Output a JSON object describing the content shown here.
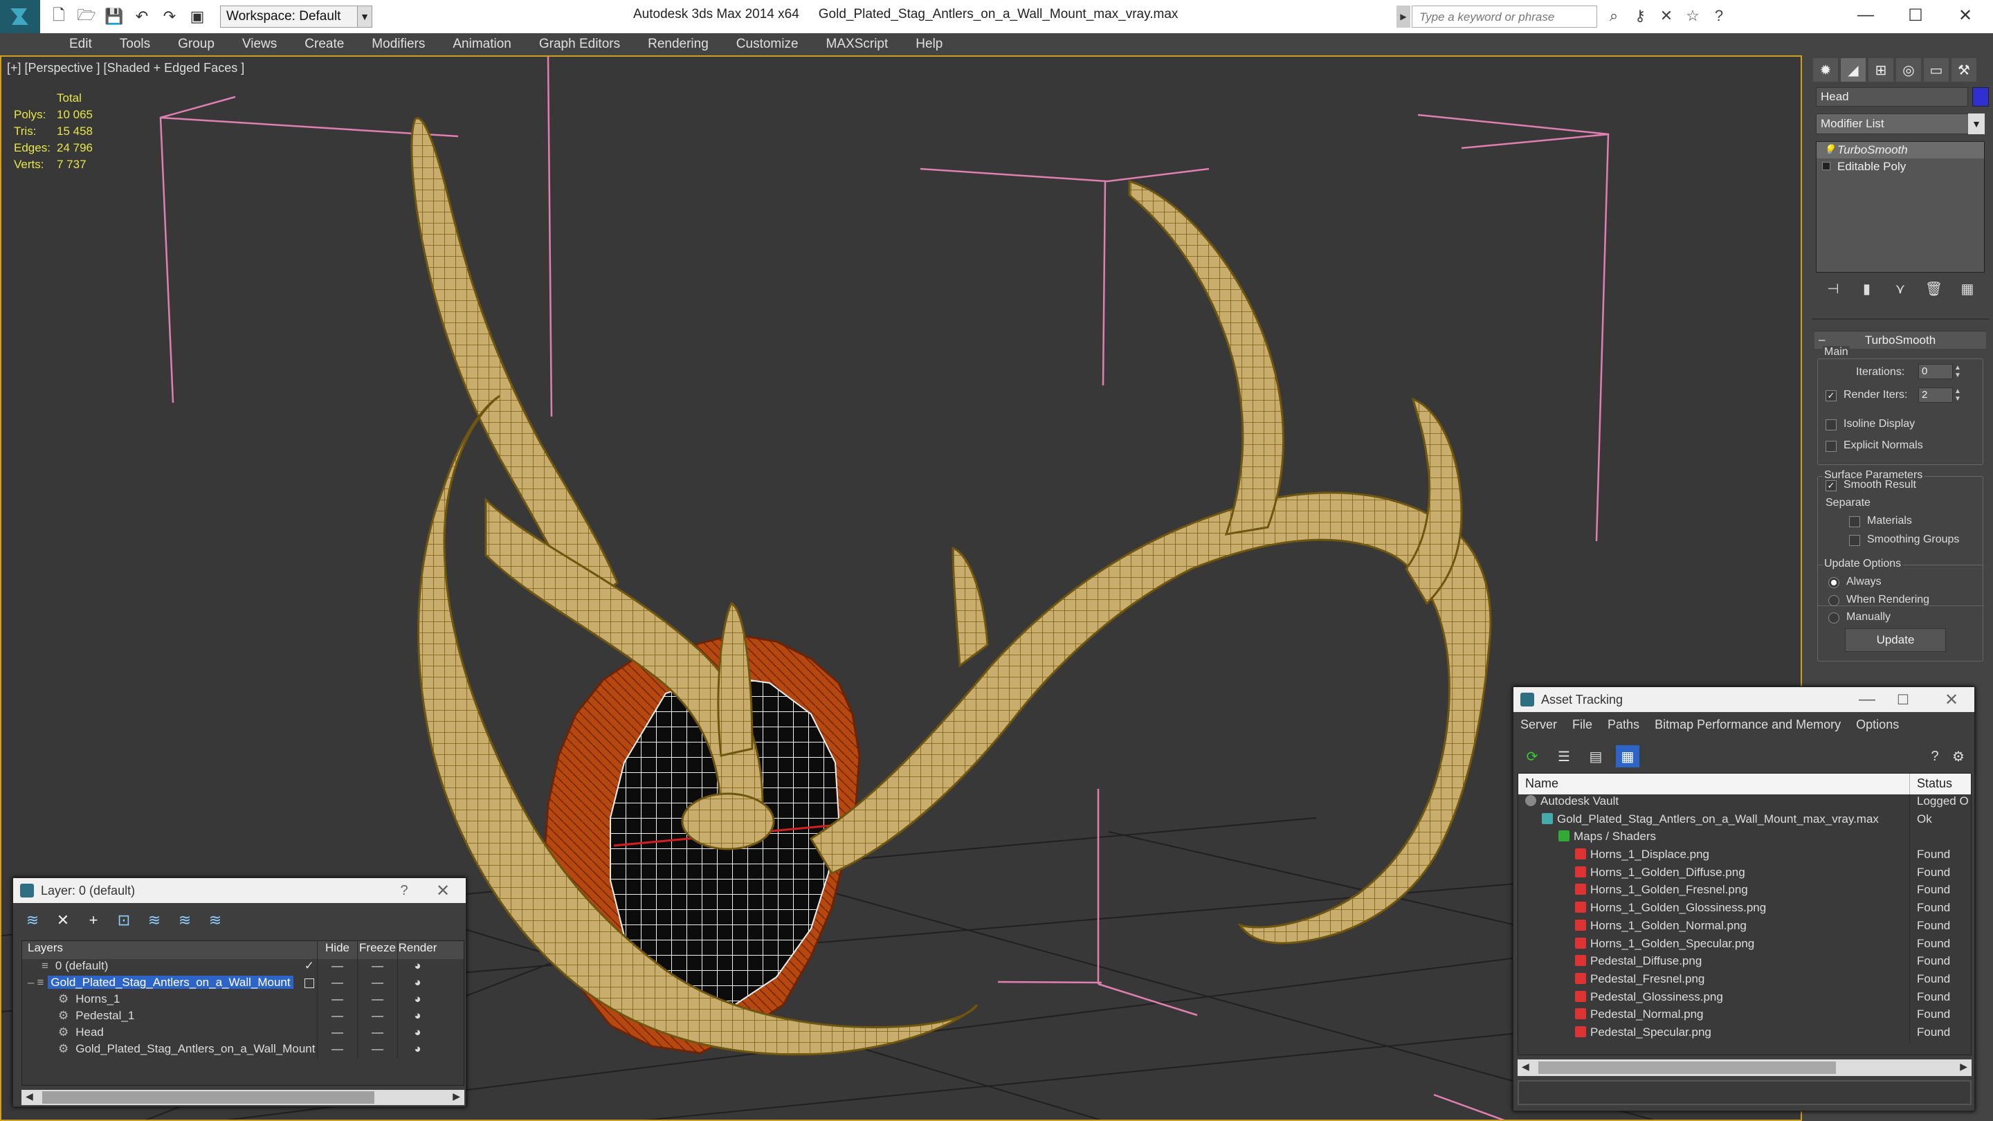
{
  "titlebar": {
    "workspace_label": "Workspace: Default",
    "app_name": "Autodesk 3ds Max  2014 x64",
    "file_name": "Gold_Plated_Stag_Antlers_on_a_Wall_Mount_max_vray.max",
    "search_placeholder": "Type a keyword or phrase"
  },
  "menu": [
    "Edit",
    "Tools",
    "Group",
    "Views",
    "Create",
    "Modifiers",
    "Animation",
    "Graph Editors",
    "Rendering",
    "Customize",
    "MAXScript",
    "Help"
  ],
  "viewport": {
    "label": "[+] [Perspective ] [Shaded + Edged Faces ]",
    "stats_header": "Total",
    "stats": [
      {
        "k": "Polys:",
        "v": "10 065"
      },
      {
        "k": "Tris:",
        "v": "15 458"
      },
      {
        "k": "Edges:",
        "v": "24 796"
      },
      {
        "k": "Verts:",
        "v": "7 737"
      }
    ]
  },
  "command_panel": {
    "object_name": "Head",
    "object_color": "#3030d0",
    "modifier_list": "Modifier List",
    "stack": [
      "TurboSmooth",
      "Editable Poly"
    ],
    "rollout_title": "TurboSmooth",
    "main_label": "Main",
    "iterations_label": "Iterations:",
    "iterations_value": "0",
    "render_iters_label": "Render Iters:",
    "render_iters_value": "2",
    "render_iters_checked": true,
    "isoline_label": "Isoline Display",
    "explicit_label": "Explicit Normals",
    "surface_label": "Surface Parameters",
    "smooth_result_label": "Smooth Result",
    "separate_label": "Separate",
    "materials_label": "Materials",
    "smoothing_groups_label": "Smoothing Groups",
    "update_options_label": "Update Options",
    "always_label": "Always",
    "when_rendering_label": "When Rendering",
    "manually_label": "Manually",
    "update_button": "Update"
  },
  "layer_dialog": {
    "title": "Layer: 0 (default)",
    "help": "?",
    "columns": [
      "Layers",
      "Hide",
      "Freeze",
      "Render"
    ],
    "rows": [
      {
        "name": "0 (default)",
        "indent": 1,
        "selected": false
      },
      {
        "name": "Gold_Plated_Stag_Antlers_on_a_Wall_Mount",
        "indent": 1,
        "selected": true
      },
      {
        "name": "Horns_1",
        "indent": 2,
        "selected": false
      },
      {
        "name": "Pedestal_1",
        "indent": 2,
        "selected": false
      },
      {
        "name": "Head",
        "indent": 2,
        "selected": false
      },
      {
        "name": "Gold_Plated_Stag_Antlers_on_a_Wall_Mount",
        "indent": 2,
        "selected": false
      }
    ]
  },
  "asset_dialog": {
    "title": "Asset Tracking",
    "menu": [
      "Server",
      "File",
      "Paths",
      "Bitmap Performance and Memory",
      "Options"
    ],
    "col_name": "Name",
    "col_status": "Status",
    "rows": [
      {
        "name": "Autodesk Vault",
        "status": "Logged O",
        "indent": 0,
        "icon": "vault"
      },
      {
        "name": "Gold_Plated_Stag_Antlers_on_a_Wall_Mount_max_vray.max",
        "status": "Ok",
        "indent": 1,
        "icon": "max"
      },
      {
        "name": "Maps / Shaders",
        "status": "",
        "indent": 2,
        "icon": "folder"
      },
      {
        "name": "Horns_1_Displace.png",
        "status": "Found",
        "indent": 3,
        "icon": "png"
      },
      {
        "name": "Horns_1_Golden_Diffuse.png",
        "status": "Found",
        "indent": 3,
        "icon": "png"
      },
      {
        "name": "Horns_1_Golden_Fresnel.png",
        "status": "Found",
        "indent": 3,
        "icon": "png"
      },
      {
        "name": "Horns_1_Golden_Glossiness.png",
        "status": "Found",
        "indent": 3,
        "icon": "png"
      },
      {
        "name": "Horns_1_Golden_Normal.png",
        "status": "Found",
        "indent": 3,
        "icon": "png"
      },
      {
        "name": "Horns_1_Golden_Specular.png",
        "status": "Found",
        "indent": 3,
        "icon": "png"
      },
      {
        "name": "Pedestal_Diffuse.png",
        "status": "Found",
        "indent": 3,
        "icon": "png"
      },
      {
        "name": "Pedestal_Fresnel.png",
        "status": "Found",
        "indent": 3,
        "icon": "png"
      },
      {
        "name": "Pedestal_Glossiness.png",
        "status": "Found",
        "indent": 3,
        "icon": "png"
      },
      {
        "name": "Pedestal_Normal.png",
        "status": "Found",
        "indent": 3,
        "icon": "png"
      },
      {
        "name": "Pedestal_Specular.png",
        "status": "Found",
        "indent": 3,
        "icon": "png"
      }
    ]
  },
  "colors": {
    "accent_selection": "#2d64c8",
    "viewport_border": "#d0a020",
    "antler_fill": "#c8ad6e",
    "pedestal": "#b5470f",
    "stats_text": "#e6e64a",
    "wireframe_pink": "#e080b0"
  }
}
